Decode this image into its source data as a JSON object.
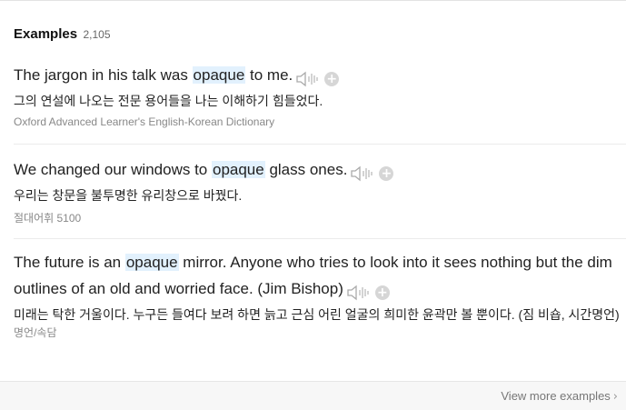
{
  "header": {
    "title": "Examples",
    "count": "2,105"
  },
  "examples": [
    {
      "en_before": "The jargon in his talk was ",
      "keyword": "opaque",
      "en_after": " to me.",
      "ko": "그의 연설에 나오는 전문 용어들을 나는 이해하기 힘들었다.",
      "source": "Oxford Advanced Learner's English-Korean Dictionary"
    },
    {
      "en_before": "We changed our windows to ",
      "keyword": "opaque",
      "en_after": " glass ones.",
      "ko": "우리는 창문을 불투명한 유리창으로 바꿨다.",
      "source": "절대어휘 5100"
    },
    {
      "en_before": "The future is an ",
      "keyword": "opaque",
      "en_after": " mirror. Anyone who tries to look into it sees nothing but the dim outlines of an old and worried face. (Jim Bishop)",
      "ko": "미래는 탁한 거울이다. 누구든 들여다 보려 하면 늙고 근심 어린 얼굴의 희미한 윤곽만 볼 뿐이다. (짐 비숍, 시간명언)",
      "source": "명언/속담"
    }
  ],
  "footer": {
    "more_label": "View more examples",
    "chevron": "›"
  },
  "icons": {
    "speaker": "speaker-icon",
    "add": "add-to-wordbook-icon"
  },
  "colors": {
    "highlight": "#e2f1fd",
    "icon_gray": "#bdbdbd"
  }
}
